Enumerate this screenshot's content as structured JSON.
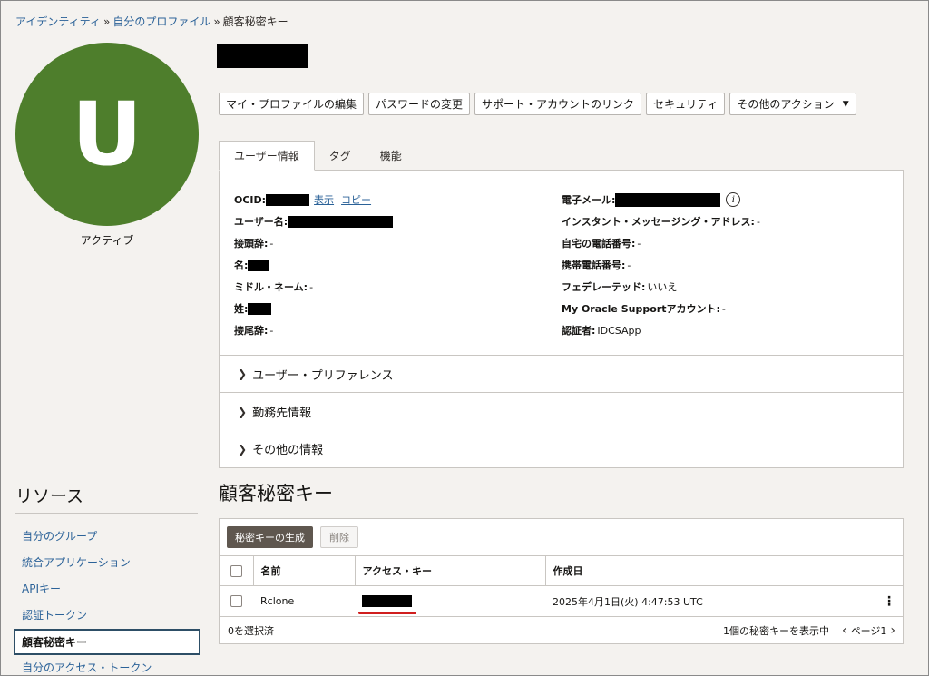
{
  "breadcrumb": {
    "items": [
      "アイデンティティ",
      "自分のプロファイル"
    ],
    "current": "顧客秘密キー",
    "separator": "»"
  },
  "profile": {
    "avatar_letter": "U",
    "avatar_color": "#4e7e2c",
    "status": "アクティブ"
  },
  "actions": {
    "edit_profile": "マイ・プロファイルの編集",
    "change_password": "パスワードの変更",
    "link_support": "サポート・アカウントのリンク",
    "security": "セキュリティ",
    "more_actions": "その他のアクション"
  },
  "tabs": [
    "ユーザー情報",
    "タグ",
    "機能"
  ],
  "user_info": {
    "left": {
      "ocid_label": "OCID:",
      "show_link": "表示",
      "copy_link": "コピー",
      "username_label": "ユーザー名:",
      "prefix_label": "接頭辞:",
      "prefix_value": "-",
      "first_name_label": "名:",
      "middle_name_label": "ミドル・ネーム:",
      "middle_name_value": "-",
      "last_name_label": "姓:",
      "suffix_label": "接尾辞:",
      "suffix_value": "-"
    },
    "right": {
      "email_label": "電子メール:",
      "im_label": "インスタント・メッセージング・アドレス:",
      "im_value": "-",
      "home_phone_label": "自宅の電話番号:",
      "home_phone_value": "-",
      "mobile_label": "携帯電話番号:",
      "mobile_value": "-",
      "federated_label": "フェデレーテッド:",
      "federated_value": "いいえ",
      "mos_label": "My Oracle Supportアカウント:",
      "mos_value": "-",
      "authenticator_label": "認証者:",
      "authenticator_value": "IDCSApp"
    }
  },
  "accordions": [
    "ユーザー・プリファレンス",
    "勤務先情報",
    "その他の情報"
  ],
  "resources": {
    "title": "リソース",
    "items": [
      "自分のグループ",
      "統合アプリケーション",
      "APIキー",
      "認証トークン",
      "顧客秘密キー",
      "自分のアクセス・トークン"
    ],
    "active_index": 4
  },
  "secret_keys": {
    "title": "顧客秘密キー",
    "generate_button": "秘密キーの生成",
    "delete_button": "削除",
    "columns": [
      "名前",
      "アクセス・キー",
      "作成日"
    ],
    "rows": [
      {
        "name": "Rclone",
        "created": "2025年4月1日(火) 4:47:53 UTC"
      }
    ],
    "selected_text": "0を選択済",
    "count_text": "1個の秘密キーを表示中",
    "page_text": "ページ1"
  },
  "colors": {
    "accent_underline": "#d01e1e",
    "primary_button": "#5f574f"
  }
}
